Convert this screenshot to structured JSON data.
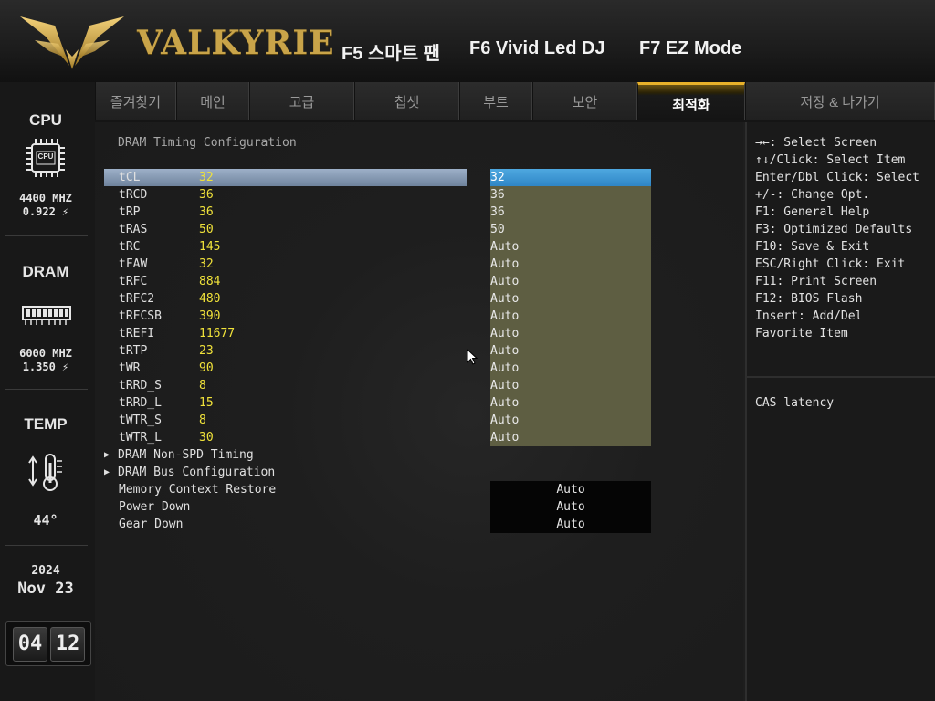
{
  "header": {
    "brand": "VALKYRIE",
    "hotkeys": [
      "F5 스마트 팬",
      "F6 Vivid Led DJ",
      "F7 EZ Mode"
    ]
  },
  "tabs": [
    {
      "label": "즐겨찾기",
      "active": false
    },
    {
      "label": "메인",
      "active": false
    },
    {
      "label": "고급",
      "active": false
    },
    {
      "label": "칩셋",
      "active": false
    },
    {
      "label": "부트",
      "active": false
    },
    {
      "label": "보안",
      "active": false
    },
    {
      "label": "최적화",
      "active": true
    },
    {
      "label": "저장 & 나가기",
      "active": false
    }
  ],
  "sidebar": {
    "cpu": {
      "title": "CPU",
      "icon_text": "CPU",
      "freq": "4400 MHZ",
      "volt": "0.922"
    },
    "dram": {
      "title": "DRAM",
      "freq": "6000 MHZ",
      "volt": "1.350"
    },
    "temp": {
      "title": "TEMP",
      "value": "44",
      "unit": "°"
    },
    "date": {
      "year": "2024",
      "month": "Nov",
      "day": "23"
    },
    "clock": {
      "hour": "04",
      "minute": "12"
    }
  },
  "main": {
    "title": "DRAM Timing Configuration",
    "timings": [
      {
        "label": "tCL",
        "current": "32",
        "setting": "32",
        "selected": true
      },
      {
        "label": "tRCD",
        "current": "36",
        "setting": "36"
      },
      {
        "label": "tRP",
        "current": "36",
        "setting": "36"
      },
      {
        "label": "tRAS",
        "current": "50",
        "setting": "50"
      },
      {
        "label": "tRC",
        "current": "145",
        "setting": "Auto"
      },
      {
        "label": "tFAW",
        "current": "32",
        "setting": "Auto"
      },
      {
        "label": "tRFC",
        "current": "884",
        "setting": "Auto"
      },
      {
        "label": "tRFC2",
        "current": "480",
        "setting": "Auto"
      },
      {
        "label": "tRFCSB",
        "current": "390",
        "setting": "Auto"
      },
      {
        "label": "tREFI",
        "current": "11677",
        "setting": "Auto"
      },
      {
        "label": "tRTP",
        "current": "23",
        "setting": "Auto"
      },
      {
        "label": "tWR",
        "current": "90",
        "setting": "Auto"
      },
      {
        "label": "tRRD_S",
        "current": "8",
        "setting": "Auto"
      },
      {
        "label": "tRRD_L",
        "current": "15",
        "setting": "Auto"
      },
      {
        "label": "tWTR_S",
        "current": "8",
        "setting": "Auto"
      },
      {
        "label": "tWTR_L",
        "current": "30",
        "setting": "Auto"
      }
    ],
    "submenus": [
      "DRAM Non-SPD Timing",
      "DRAM Bus Configuration"
    ],
    "options": [
      {
        "label": "Memory Context Restore",
        "value": "Auto"
      },
      {
        "label": "Power Down",
        "value": "Auto"
      },
      {
        "label": "Gear Down",
        "value": "Auto"
      }
    ]
  },
  "help": {
    "keys": [
      "→←: Select Screen",
      "↑↓/Click: Select Item",
      "Enter/Dbl Click: Select",
      "+/-: Change Opt.",
      "F1: General Help",
      "F3: Optimized Defaults",
      "F10: Save & Exit",
      "ESC/Right Click: Exit",
      "F11: Print Screen",
      "F12: BIOS Flash",
      "Insert: Add/Del",
      "Favorite Item"
    ],
    "description": "CAS latency"
  },
  "colors": {
    "accent_gold": "#e8b12a",
    "current_value": "#f0e23a",
    "selected_value_bg": "#2f86c6",
    "setting_bg": "#5e5e42"
  }
}
